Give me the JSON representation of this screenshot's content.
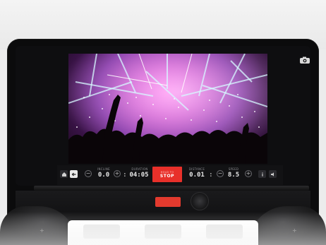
{
  "metrics": {
    "incline": {
      "label": "INCLINE",
      "value": "0.0"
    },
    "duration": {
      "label": "DURATION",
      "value": "04:05"
    },
    "distance": {
      "label": "DISTANCE",
      "value": "0.01"
    },
    "speed": {
      "label": "SPEED",
      "value": "8.5"
    }
  },
  "stop_button": {
    "top_label": "HOLD TO",
    "label": "STOP"
  },
  "controls": {
    "minus": "−",
    "plus": "+",
    "separator": ":"
  },
  "icons": {
    "home": "home-icon",
    "back": "back-arrow-icon",
    "camera": "camera-icon",
    "info": "info-icon",
    "volume": "volume-icon"
  },
  "colors": {
    "accent_stop": "#e8302a",
    "bezel": "#0b0b0c",
    "value_text": "#e8e8e8"
  }
}
